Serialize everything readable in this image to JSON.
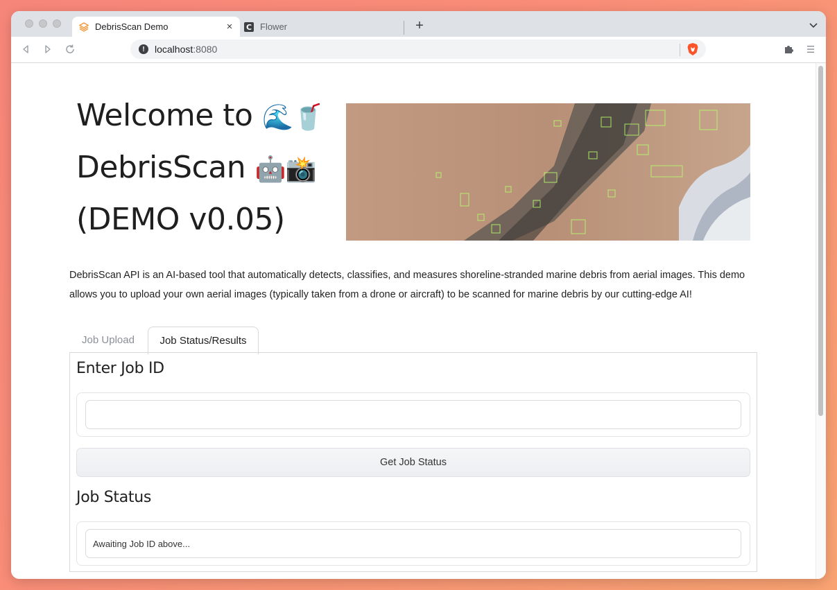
{
  "browser": {
    "tabs": [
      {
        "title": "DebrisScan Demo",
        "active": true,
        "icon": "gradio-icon"
      },
      {
        "title": "Flower",
        "active": false,
        "icon": "c-letter-icon"
      }
    ],
    "new_tab": "+",
    "close_tab": "×",
    "url_host": "localhost",
    "url_port": ":8080"
  },
  "page": {
    "title_line1": "Welcome to",
    "title_emoji1": "🌊🥤",
    "title_line2": "DebrisScan",
    "title_emoji2": "🤖📸",
    "title_line3": "(DEMO v0.05)",
    "intro": "DebrisScan API is an AI-based tool that automatically detects, classifies, and measures shoreline-stranded marine debris from aerial images. This demo allows you to upload your own aerial images (typically taken from a drone or aircraft) to be scanned for marine debris by our cutting-edge AI!",
    "tabs": [
      "Job Upload",
      "Job Status/Results"
    ],
    "active_tab": "Job Status/Results",
    "enter_job_heading": "Enter Job ID",
    "job_id_value": "",
    "get_status_button": "Get Job Status",
    "job_status_heading": "Job Status",
    "job_status_value": "Awaiting Job ID above..."
  },
  "colors": {
    "accent_orange": "#f29a38",
    "detection_box": "#b5ff6a",
    "brave_orange": "#fb542b"
  }
}
